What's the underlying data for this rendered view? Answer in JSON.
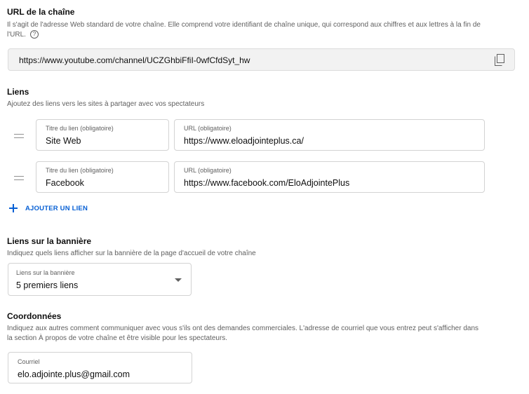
{
  "url_section": {
    "title": "URL de la chaîne",
    "desc_line1": "Il s'agit de l'adresse Web standard de votre chaîne. Elle comprend votre identifiant de chaîne unique, qui correspond aux chiffres et aux lettres à la fin de",
    "desc_line2": "l'URL.",
    "help_glyph": "?",
    "url": "https://www.youtube.com/channel/UCZGhbiFfiI-0wfCfdSyt_hw",
    "copy_icon": "copy-icon"
  },
  "links_section": {
    "title": "Liens",
    "desc": "Ajoutez des liens vers les sites à partager avec vos spectateurs",
    "links": [
      {
        "title_label": "Titre du lien (obligatoire)",
        "title_value": "Site Web",
        "url_label": "URL (obligatoire)",
        "url_value": "https://www.eloadjointeplus.ca/"
      },
      {
        "title_label": "Titre du lien (obligatoire)",
        "title_value": "Facebook",
        "url_label": "URL (obligatoire)",
        "url_value": "https://www.facebook.com/EloAdjointePlus"
      }
    ],
    "add_label": "AJOUTER UN LIEN"
  },
  "banner_section": {
    "title": "Liens sur la bannière",
    "desc": "Indiquez quels liens afficher sur la bannière de la page d'accueil de votre chaîne",
    "select_label": "Liens sur la bannière",
    "select_value": "5 premiers liens"
  },
  "contact_section": {
    "title": "Coordonnées",
    "desc_line1": "Indiquez aux autres comment communiquer avec vous s'ils ont des demandes commerciales. L'adresse de courriel que vous entrez peut s'afficher dans",
    "desc_line2": "la section À propos de votre chaîne et être visible pour les spectateurs.",
    "email_label": "Courriel",
    "email_value": "elo.adjointe.plus@gmail.com"
  },
  "colors": {
    "accent": "#065fd4",
    "secondary_text": "#606060",
    "border": "#d3d3d3"
  }
}
